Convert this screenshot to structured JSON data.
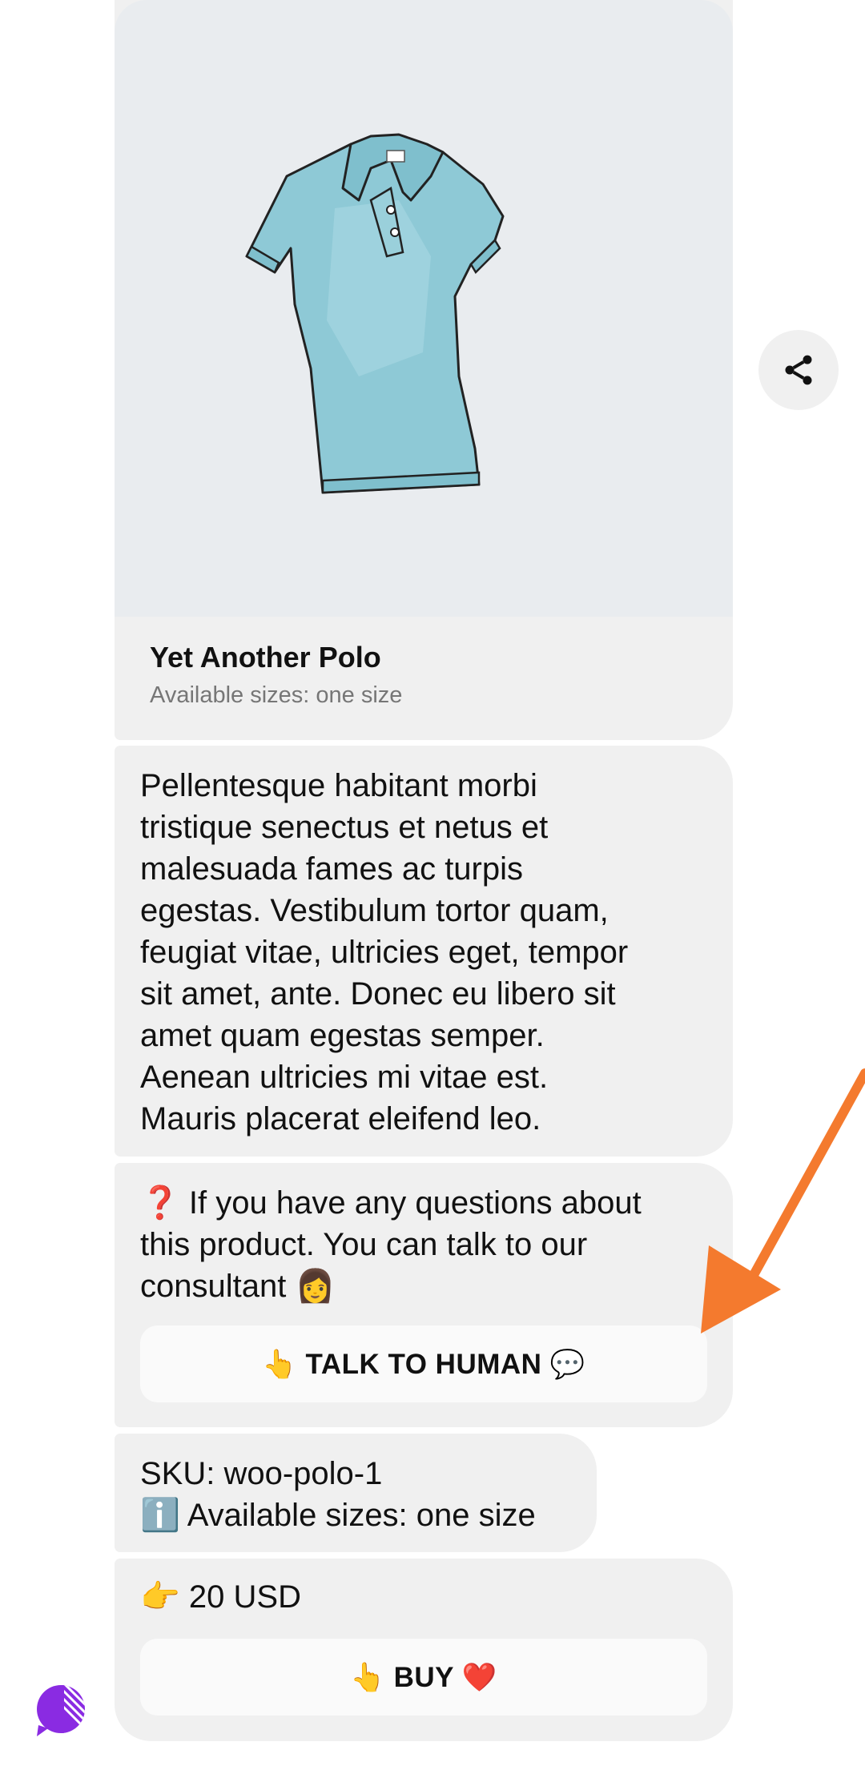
{
  "product": {
    "title": "Yet Another Polo",
    "subtitle": "Available sizes: one size",
    "image_icon": "polo-shirt-illustration"
  },
  "share_icon": "share-icon",
  "messages": {
    "description": "Pellentesque habitant morbi\ntristique senectus et netus et\nmalesuada fames ac turpis\negestas. Vestibulum tortor quam,\nfeugiat vitae, ultricies eget, tempor\nsit amet, ante. Donec eu libero sit\namet quam egestas semper.\nAenean ultricies mi vitae est.\nMauris placerat eleifend leo.",
    "question": "❓ If you have any questions about\nthis product. You can talk to our\nconsultant 👩",
    "talk_button_label": "👆 TALK TO HUMAN 💬",
    "sku": "SKU: woo-polo-1\nℹ️ Available sizes: one size",
    "price": "👉 20 USD",
    "buy_button_label": "👆 BUY ❤️"
  },
  "colors": {
    "annotation_arrow": "#f47a2e",
    "bubble_bg": "#f0f0f0",
    "image_bg": "#e9ecef",
    "brand_purple": "#8a2be2"
  }
}
